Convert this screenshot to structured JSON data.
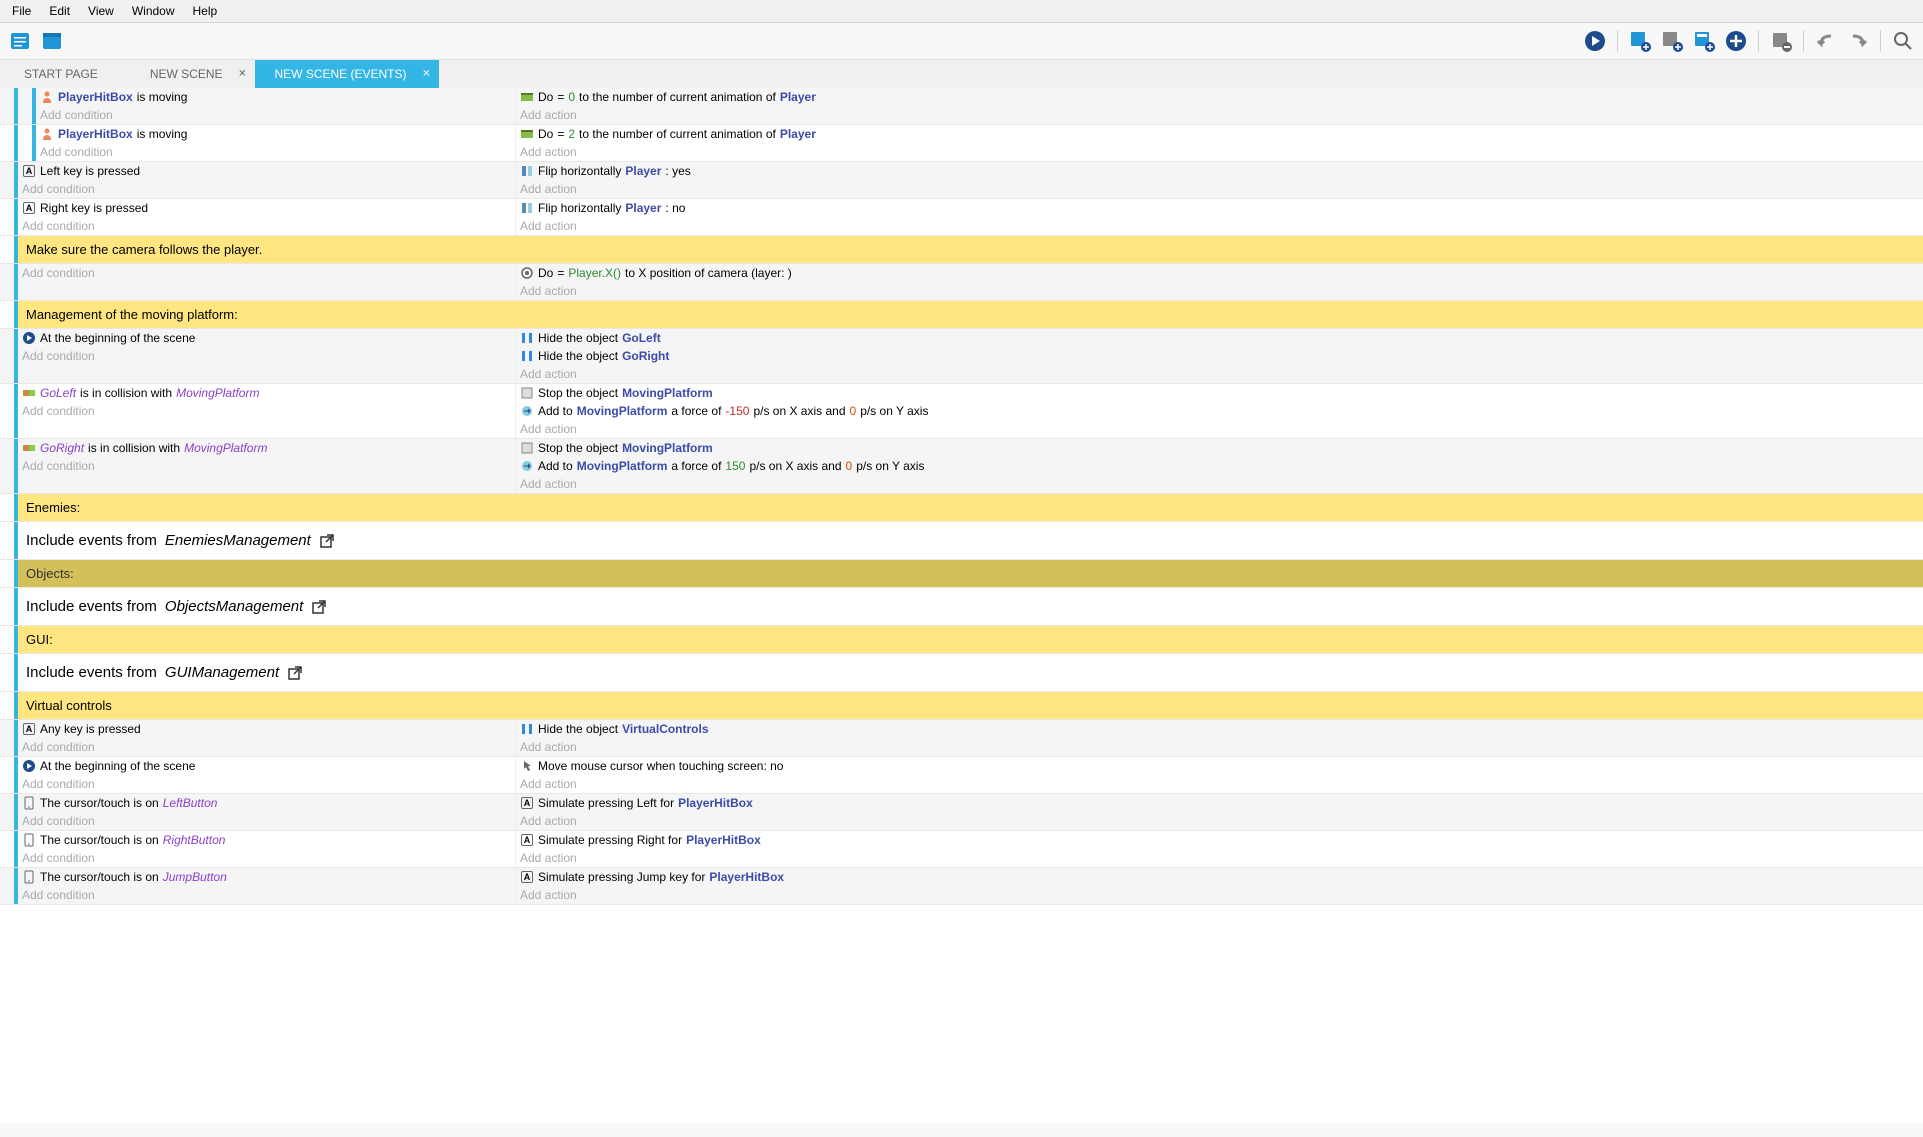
{
  "menu": {
    "file": "File",
    "edit": "Edit",
    "view": "View",
    "window": "Window",
    "help": "Help"
  },
  "tabs": {
    "start": "START PAGE",
    "scene": "NEW SCENE",
    "events": "NEW SCENE (EVENTS)"
  },
  "common": {
    "add_condition": "Add condition",
    "add_action": "Add action",
    "include": "Include events from",
    "open_icon": "↗"
  },
  "events": [
    {
      "type": "sub",
      "depth": 2,
      "bg": "#f5f5f5",
      "conditions": [
        {
          "icon": "person",
          "parts": [
            [
              "obj",
              "PlayerHitBox"
            ],
            [
              "t",
              " is moving"
            ]
          ]
        }
      ],
      "actions": [
        {
          "icon": "anim",
          "parts": [
            [
              "t",
              "Do "
            ],
            [
              "t",
              "= "
            ],
            [
              "num-green",
              "0"
            ],
            [
              "t",
              " to the number of current animation of "
            ],
            [
              "obj",
              "Player"
            ]
          ]
        }
      ]
    },
    {
      "type": "sub",
      "depth": 2,
      "bg": "#fff",
      "conditions": [
        {
          "icon": "person",
          "parts": [
            [
              "obj",
              "PlayerHitBox"
            ],
            [
              "t",
              " is moving"
            ]
          ]
        }
      ],
      "actions": [
        {
          "icon": "anim",
          "parts": [
            [
              "t",
              "Do "
            ],
            [
              "t",
              "= "
            ],
            [
              "num-green",
              "2"
            ],
            [
              "t",
              " to the number of current animation of "
            ],
            [
              "obj",
              "Player"
            ]
          ]
        }
      ]
    },
    {
      "type": "row",
      "depth": 1,
      "bg": "#f5f5f5",
      "conditions": [
        {
          "icon": "key",
          "parts": [
            [
              "t",
              "Left key is pressed"
            ]
          ]
        }
      ],
      "actions": [
        {
          "icon": "flip",
          "parts": [
            [
              "t",
              "Flip horizontally "
            ],
            [
              "obj",
              "Player"
            ],
            [
              "t",
              " : yes"
            ]
          ]
        }
      ]
    },
    {
      "type": "row",
      "depth": 1,
      "bg": "#fff",
      "conditions": [
        {
          "icon": "key",
          "parts": [
            [
              "t",
              "Right key is pressed"
            ]
          ]
        }
      ],
      "actions": [
        {
          "icon": "flip",
          "parts": [
            [
              "t",
              "Flip horizontally "
            ],
            [
              "obj",
              "Player"
            ],
            [
              "t",
              " : no"
            ]
          ]
        }
      ]
    },
    {
      "type": "comment",
      "style": "yellow",
      "text": "Make sure the camera follows the player."
    },
    {
      "type": "row",
      "depth": 1,
      "bg": "#f5f5f5",
      "conditions": [],
      "actions": [
        {
          "icon": "camera",
          "parts": [
            [
              "t",
              "Do "
            ],
            [
              "t",
              "= "
            ],
            [
              "num-green",
              "Player.X()"
            ],
            [
              "t",
              " to X position of camera (layer: )"
            ]
          ]
        }
      ]
    },
    {
      "type": "comment",
      "style": "yellow",
      "text": "Management of the moving platform:"
    },
    {
      "type": "row",
      "depth": 1,
      "bg": "#f5f5f5",
      "conditions": [
        {
          "icon": "play",
          "parts": [
            [
              "t",
              "At the beginning of the scene"
            ]
          ]
        }
      ],
      "actions": [
        {
          "icon": "hide",
          "parts": [
            [
              "t",
              "Hide the object "
            ],
            [
              "obj",
              "GoLeft"
            ]
          ]
        },
        {
          "icon": "hide",
          "parts": [
            [
              "t",
              "Hide the object "
            ],
            [
              "obj",
              "GoRight"
            ]
          ]
        }
      ]
    },
    {
      "type": "row",
      "depth": 1,
      "bg": "#fff",
      "conditions": [
        {
          "icon": "collision",
          "parts": [
            [
              "obj-purple",
              "GoLeft"
            ],
            [
              "t",
              " is in collision with "
            ],
            [
              "obj-purple",
              "MovingPlatform"
            ]
          ]
        }
      ],
      "actions": [
        {
          "icon": "stop",
          "parts": [
            [
              "t",
              "Stop the object "
            ],
            [
              "obj",
              "MovingPlatform"
            ]
          ]
        },
        {
          "icon": "force",
          "parts": [
            [
              "t",
              "Add to "
            ],
            [
              "obj",
              "MovingPlatform"
            ],
            [
              "t",
              " a force of "
            ],
            [
              "num-neg",
              "-150"
            ],
            [
              "t",
              " p/s on X axis and "
            ],
            [
              "num",
              "0"
            ],
            [
              "t",
              " p/s on Y axis"
            ]
          ]
        }
      ]
    },
    {
      "type": "row",
      "depth": 1,
      "bg": "#f5f5f5",
      "conditions": [
        {
          "icon": "collision",
          "parts": [
            [
              "obj-purple",
              "GoRight"
            ],
            [
              "t",
              " is in collision with "
            ],
            [
              "obj-purple",
              "MovingPlatform"
            ]
          ]
        }
      ],
      "actions": [
        {
          "icon": "stop",
          "parts": [
            [
              "t",
              "Stop the object "
            ],
            [
              "obj",
              "MovingPlatform"
            ]
          ]
        },
        {
          "icon": "force",
          "parts": [
            [
              "t",
              "Add to "
            ],
            [
              "obj",
              "MovingPlatform"
            ],
            [
              "t",
              " a force of "
            ],
            [
              "num-green",
              "150"
            ],
            [
              "t",
              " p/s on X axis and "
            ],
            [
              "num",
              "0"
            ],
            [
              "t",
              " p/s on Y axis"
            ]
          ]
        }
      ]
    },
    {
      "type": "comment",
      "style": "yellow",
      "text": "Enemies:"
    },
    {
      "type": "include",
      "name": "EnemiesManagement"
    },
    {
      "type": "comment",
      "style": "gold",
      "text": "Objects:"
    },
    {
      "type": "include",
      "name": "ObjectsManagement"
    },
    {
      "type": "comment",
      "style": "yellow",
      "text": "GUI:"
    },
    {
      "type": "include",
      "name": "GUIManagement"
    },
    {
      "type": "comment",
      "style": "yellow",
      "text": "Virtual controls"
    },
    {
      "type": "row",
      "depth": 1,
      "bg": "#f5f5f5",
      "conditions": [
        {
          "icon": "key",
          "parts": [
            [
              "t",
              "Any key is pressed"
            ]
          ]
        }
      ],
      "actions": [
        {
          "icon": "hide",
          "parts": [
            [
              "t",
              "Hide the object "
            ],
            [
              "obj",
              "VirtualControls"
            ]
          ]
        }
      ]
    },
    {
      "type": "row",
      "depth": 1,
      "bg": "#fff",
      "conditions": [
        {
          "icon": "play",
          "parts": [
            [
              "t",
              "At the beginning of the scene"
            ]
          ]
        }
      ],
      "actions": [
        {
          "icon": "mouse",
          "parts": [
            [
              "t",
              "Move mouse cursor when touching screen: no"
            ]
          ]
        }
      ]
    },
    {
      "type": "row",
      "depth": 1,
      "bg": "#f5f5f5",
      "conditions": [
        {
          "icon": "touch",
          "parts": [
            [
              "t",
              "The cursor/touch is on "
            ],
            [
              "obj-purple",
              "LeftButton"
            ]
          ]
        }
      ],
      "actions": [
        {
          "icon": "key",
          "parts": [
            [
              "t",
              "Simulate pressing Left for "
            ],
            [
              "obj",
              "PlayerHitBox"
            ]
          ]
        }
      ]
    },
    {
      "type": "row",
      "depth": 1,
      "bg": "#fff",
      "conditions": [
        {
          "icon": "touch",
          "parts": [
            [
              "t",
              "The cursor/touch is on "
            ],
            [
              "obj-purple",
              "RightButton"
            ]
          ]
        }
      ],
      "actions": [
        {
          "icon": "key",
          "parts": [
            [
              "t",
              "Simulate pressing Right for "
            ],
            [
              "obj",
              "PlayerHitBox"
            ]
          ]
        }
      ]
    },
    {
      "type": "row",
      "depth": 1,
      "bg": "#f5f5f5",
      "conditions": [
        {
          "icon": "touch",
          "parts": [
            [
              "t",
              "The cursor/touch is on "
            ],
            [
              "obj-purple",
              "JumpButton"
            ]
          ]
        }
      ],
      "actions": [
        {
          "icon": "key",
          "parts": [
            [
              "t",
              "Simulate pressing Jump key for "
            ],
            [
              "obj",
              "PlayerHitBox"
            ]
          ]
        }
      ]
    }
  ]
}
